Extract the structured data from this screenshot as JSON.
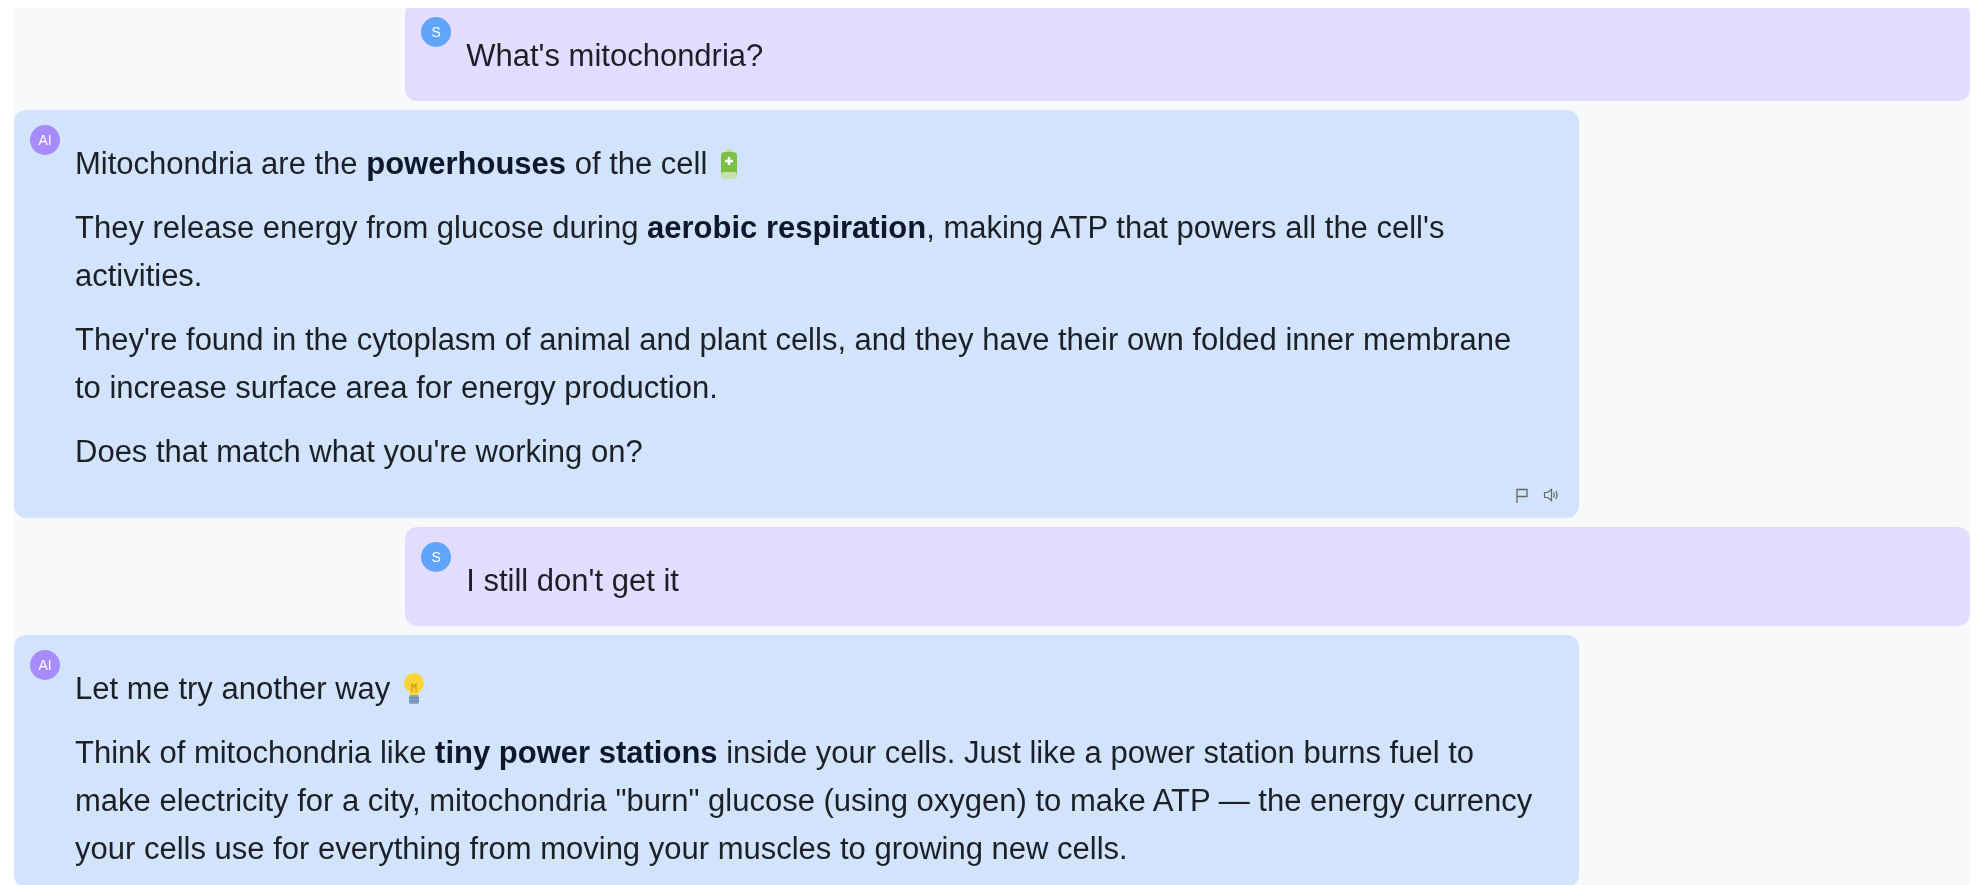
{
  "messages": [
    {
      "kind": "user",
      "avatar": "S",
      "paragraphs": [
        "What's mitochondria?"
      ]
    },
    {
      "kind": "assistant",
      "avatar": "AI",
      "heading": {
        "text": "Mitochondria are the **powerhouses** of the cell",
        "kind": "battery"
      },
      "paragraphs": [
        "They release energy from glucose during **aerobic respiration**, making ATP that powers all the cell's activities.",
        "They're found in the cytoplasm of animal and plant cells, and they have their own folded inner membrane to increase surface area for energy production.",
        "Does that match what you're working on?"
      ],
      "show_actions": true
    },
    {
      "kind": "user",
      "avatar": "S",
      "paragraphs": [
        "I still don't get it"
      ]
    },
    {
      "kind": "assistant",
      "avatar": "AI",
      "heading": {
        "text": "Let me try another way",
        "kind": "bulb"
      },
      "paragraphs": [
        "Think of mitochondria like **tiny power stations** inside your cells. Just like a power station burns fuel to make electricity for a city, mitochondria \"burn\" glucose (using oxygen) to make ATP — the energy currency your cells use for everything from moving your muscles to growing new cells."
      ],
      "show_actions": false
    }
  ]
}
